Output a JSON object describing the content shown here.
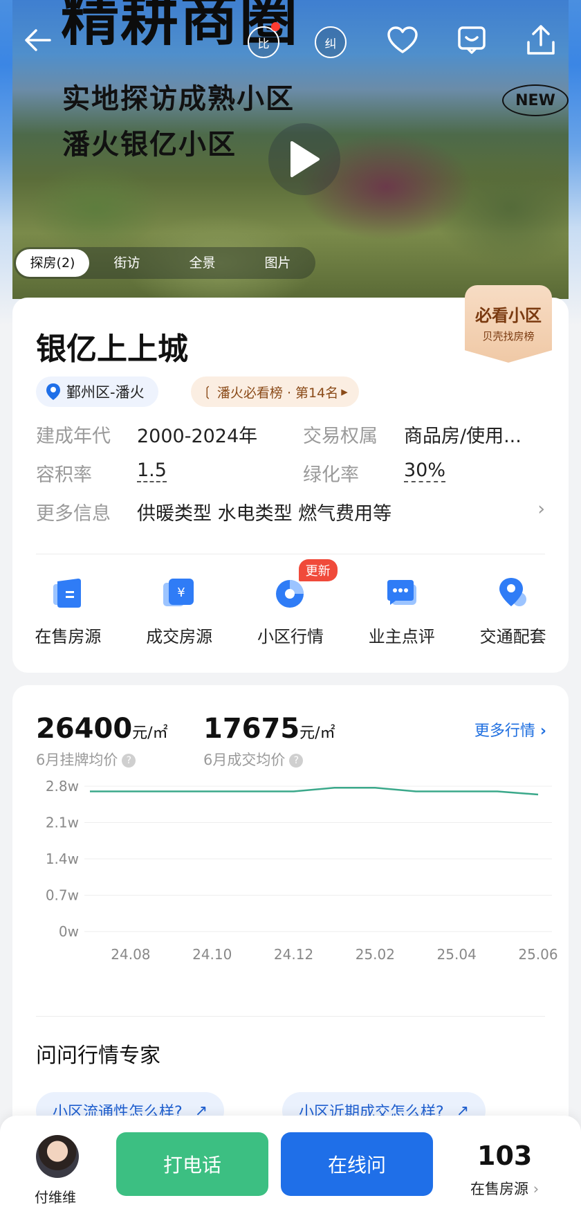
{
  "hero": {
    "title": "精耕商圈",
    "subtitle_1": "实地探访成熟小区",
    "subtitle_2": "潘火银亿小区",
    "new_badge": "NEW",
    "compare_chip": "比",
    "correct_chip": "纠",
    "media_tabs": [
      "探房(2)",
      "街访",
      "全景",
      "图片"
    ]
  },
  "community": {
    "name": "银亿上上城",
    "location": "鄞州区-潘火",
    "rank": "潘火必看榜 · 第14名",
    "must_see_title": "必看小区",
    "must_see_sub": "贝壳找房榜",
    "rows": [
      {
        "label": "建成年代",
        "value": "2000-2024年",
        "label2": "交易权属",
        "value2": "商品房/使用..."
      },
      {
        "label": "容积率",
        "value": "1.5",
        "label2": "绿化率",
        "value2": "30%"
      },
      {
        "label": "更多信息",
        "value": "供暖类型 水电类型 燃气费用等"
      }
    ],
    "entries": [
      {
        "label": "在售房源"
      },
      {
        "label": "成交房源"
      },
      {
        "label": "小区行情",
        "badge": "更新"
      },
      {
        "label": "业主点评"
      },
      {
        "label": "交通配套"
      }
    ]
  },
  "market": {
    "listing_price": "26400",
    "listing_unit": "元/㎡",
    "listing_caption": "6月挂牌均价",
    "deal_price": "17675",
    "deal_unit": "元/㎡",
    "deal_caption": "6月成交均价",
    "more_link": "更多行情",
    "experts_title": "问问行情专家",
    "question_chips": [
      "小区流通性怎么样?",
      "小区近期成交怎么样?"
    ]
  },
  "chart_data": {
    "type": "line",
    "x": [
      "24.07",
      "24.08",
      "24.09",
      "24.10",
      "24.11",
      "24.12",
      "25.01",
      "25.02",
      "25.03",
      "25.04",
      "25.05",
      "25.06"
    ],
    "x_tick_labels": [
      "24.08",
      "24.10",
      "24.12",
      "25.02",
      "25.04",
      "25.06"
    ],
    "y_tick_labels": [
      "2.8w",
      "2.1w",
      "1.4w",
      "0.7w",
      "0w"
    ],
    "ylim": [
      0,
      28000
    ],
    "series": [
      {
        "values": [
          27000,
          27000,
          27000,
          27000,
          27000,
          27000,
          27700,
          27700,
          27000,
          27000,
          27000,
          26400
        ]
      }
    ],
    "colors": {
      "line": "#3aa88a"
    },
    "grid": true
  },
  "bottom": {
    "agent_name": "付维维",
    "call_label": "打电话",
    "ask_label": "在线问",
    "listing_count": "103",
    "listing_label": "在售房源"
  }
}
